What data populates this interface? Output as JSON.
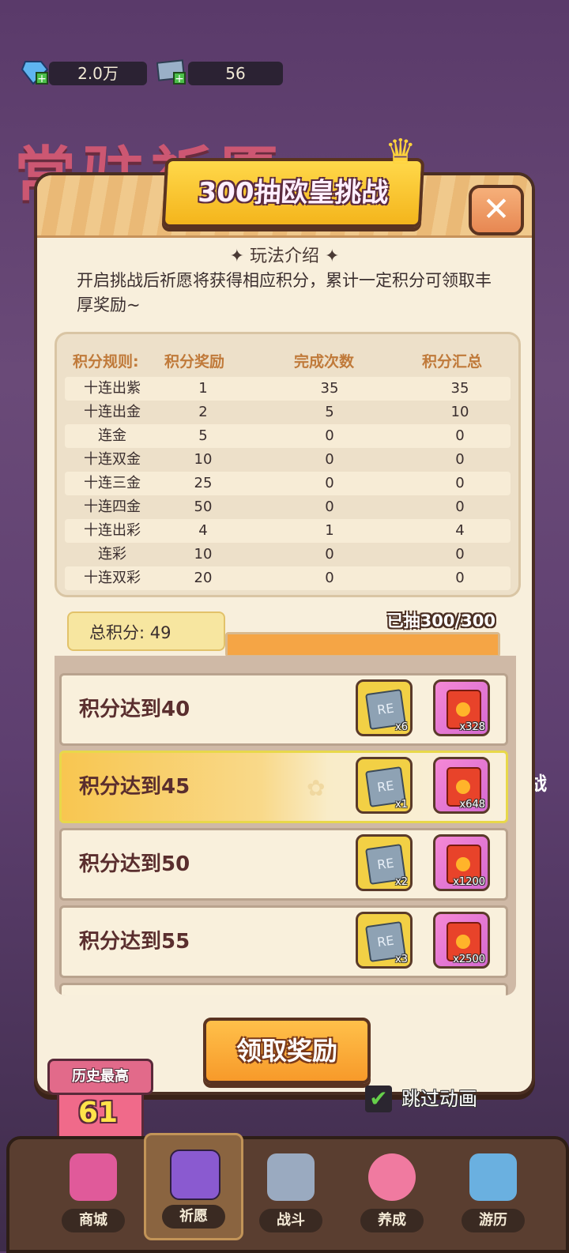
{
  "topbar": {
    "gems": "2.0万",
    "tickets": "56"
  },
  "background": {
    "title": "常驻祈愿",
    "challenge_side": "战"
  },
  "modal": {
    "title": "300抽欧皇挑战",
    "close": "✕",
    "intro_title": "✦ 玩法介绍 ✦",
    "intro_text": "开启挑战后祈愿将获得相应积分，累计一定积分可领取丰厚奖励~"
  },
  "rules": {
    "headers": [
      "积分规则:",
      "积分奖励",
      "完成次数",
      "积分汇总"
    ],
    "rows": [
      {
        "name": "十连出紫",
        "points": "1",
        "count": "35",
        "total": "35"
      },
      {
        "name": "十连出金",
        "points": "2",
        "count": "5",
        "total": "10"
      },
      {
        "name": "连金",
        "points": "5",
        "count": "0",
        "total": "0"
      },
      {
        "name": "十连双金",
        "points": "10",
        "count": "0",
        "total": "0"
      },
      {
        "name": "十连三金",
        "points": "25",
        "count": "0",
        "total": "0"
      },
      {
        "name": "十连四金",
        "points": "50",
        "count": "0",
        "total": "0"
      },
      {
        "name": "十连出彩",
        "points": "4",
        "count": "1",
        "total": "4"
      },
      {
        "name": "连彩",
        "points": "10",
        "count": "0",
        "total": "0"
      },
      {
        "name": "十连双彩",
        "points": "20",
        "count": "0",
        "total": "0"
      }
    ]
  },
  "progress": {
    "total_label": "总积分: 49",
    "drawn_label": "已抽300/300",
    "fraction": 1.0
  },
  "rewards": [
    {
      "label": "积分达到40",
      "ticket_qty": "x6",
      "red_qty": "x328",
      "highlight": false
    },
    {
      "label": "积分达到45",
      "ticket_qty": "x1",
      "red_qty": "x648",
      "highlight": true
    },
    {
      "label": "积分达到50",
      "ticket_qty": "x2",
      "red_qty": "x1200",
      "highlight": false
    },
    {
      "label": "积分达到55",
      "ticket_qty": "x3",
      "red_qty": "x2500",
      "highlight": false
    }
  ],
  "claim_button": "领取奖励",
  "history": {
    "label": "历史最高",
    "value": "61"
  },
  "skip": {
    "label": "跳过动画",
    "checked": true
  },
  "nav": [
    {
      "label": "商城",
      "icon": "shop-icon",
      "active": false,
      "color": "#e05a9a"
    },
    {
      "label": "祈愿",
      "icon": "wish-card-icon",
      "active": true,
      "color": "#8a5ad0"
    },
    {
      "label": "战斗",
      "icon": "crossed-swords-icon",
      "active": false,
      "color": "#9aaac0"
    },
    {
      "label": "养成",
      "icon": "paw-icon",
      "active": false,
      "color": "#f07aa0"
    },
    {
      "label": "游历",
      "icon": "map-icon",
      "active": false,
      "color": "#6ab0e0"
    }
  ]
}
